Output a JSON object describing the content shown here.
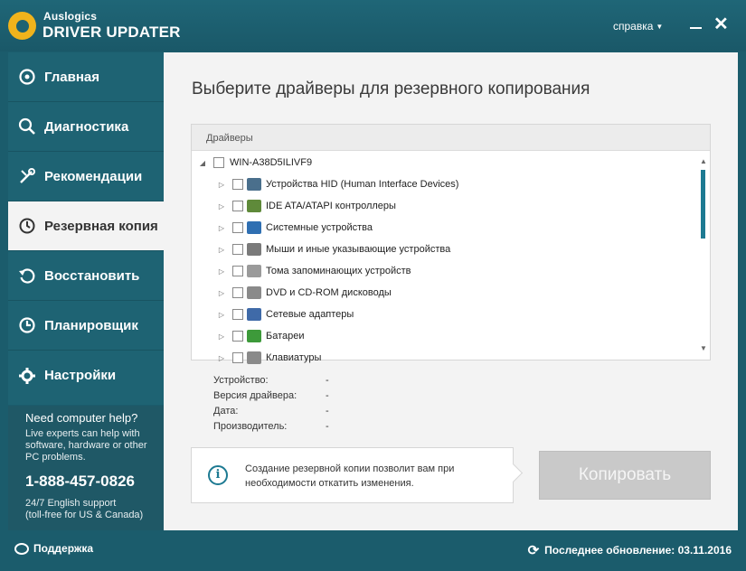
{
  "app": {
    "brand_line1": "Auslogics",
    "brand_line2": "DRIVER UPDATER",
    "help_menu": "справка"
  },
  "sidebar": {
    "items": [
      {
        "label": "Главная",
        "icon": "target-icon"
      },
      {
        "label": "Диагностика",
        "icon": "search-icon"
      },
      {
        "label": "Рекомендации",
        "icon": "tools-icon"
      },
      {
        "label": "Резервная копия",
        "icon": "clock-icon",
        "active": true
      },
      {
        "label": "Восстановить",
        "icon": "restore-icon"
      },
      {
        "label": "Планировщик",
        "icon": "scheduler-icon"
      },
      {
        "label": "Настройки",
        "icon": "gear-icon"
      }
    ]
  },
  "help": {
    "title": "Need computer help?",
    "text": "Live experts can help with software, hardware or other PC problems.",
    "phone": "1-888-457-0826",
    "line1": "24/7 English support",
    "line2": "(toll-free for US & Canada)"
  },
  "main": {
    "title": "Выберите драйверы для резервного копирования",
    "tree_header": "Драйверы",
    "root": "WIN-A38D5ILIVF9",
    "devices": [
      {
        "label": "Устройства HID (Human Interface Devices)",
        "icon_color": "#4a6f8c"
      },
      {
        "label": "IDE ATA/ATAPI контроллеры",
        "icon_color": "#5f8a3a"
      },
      {
        "label": "Системные устройства",
        "icon_color": "#2f6fb2"
      },
      {
        "label": "Мыши и иные указывающие устройства",
        "icon_color": "#7a7a7a"
      },
      {
        "label": "Тома запоминающих устройств",
        "icon_color": "#9a9a9a"
      },
      {
        "label": "DVD и CD-ROM дисководы",
        "icon_color": "#8a8a8a"
      },
      {
        "label": "Сетевые адаптеры",
        "icon_color": "#3f6aa8"
      },
      {
        "label": "Батареи",
        "icon_color": "#3d9a3a"
      },
      {
        "label": "Клавиатуры",
        "icon_color": "#8a8a8a"
      }
    ],
    "details": [
      {
        "label": "Устройство:",
        "value": "-"
      },
      {
        "label": "Версия драйвера:",
        "value": "-"
      },
      {
        "label": "Дата:",
        "value": "-"
      },
      {
        "label": "Производитель:",
        "value": "-"
      }
    ],
    "info": "Создание резервной копии позволит вам при необходимости откатить изменения.",
    "copy_button": "Копировать"
  },
  "footer": {
    "support": "Поддержка",
    "last_update": "Последнее обновление: 03.11.2016"
  },
  "colors": {
    "frame": "#1b5c6c",
    "sidebar": "#1e6373",
    "accent": "#1d7a92",
    "logo": "#f0b31c"
  }
}
